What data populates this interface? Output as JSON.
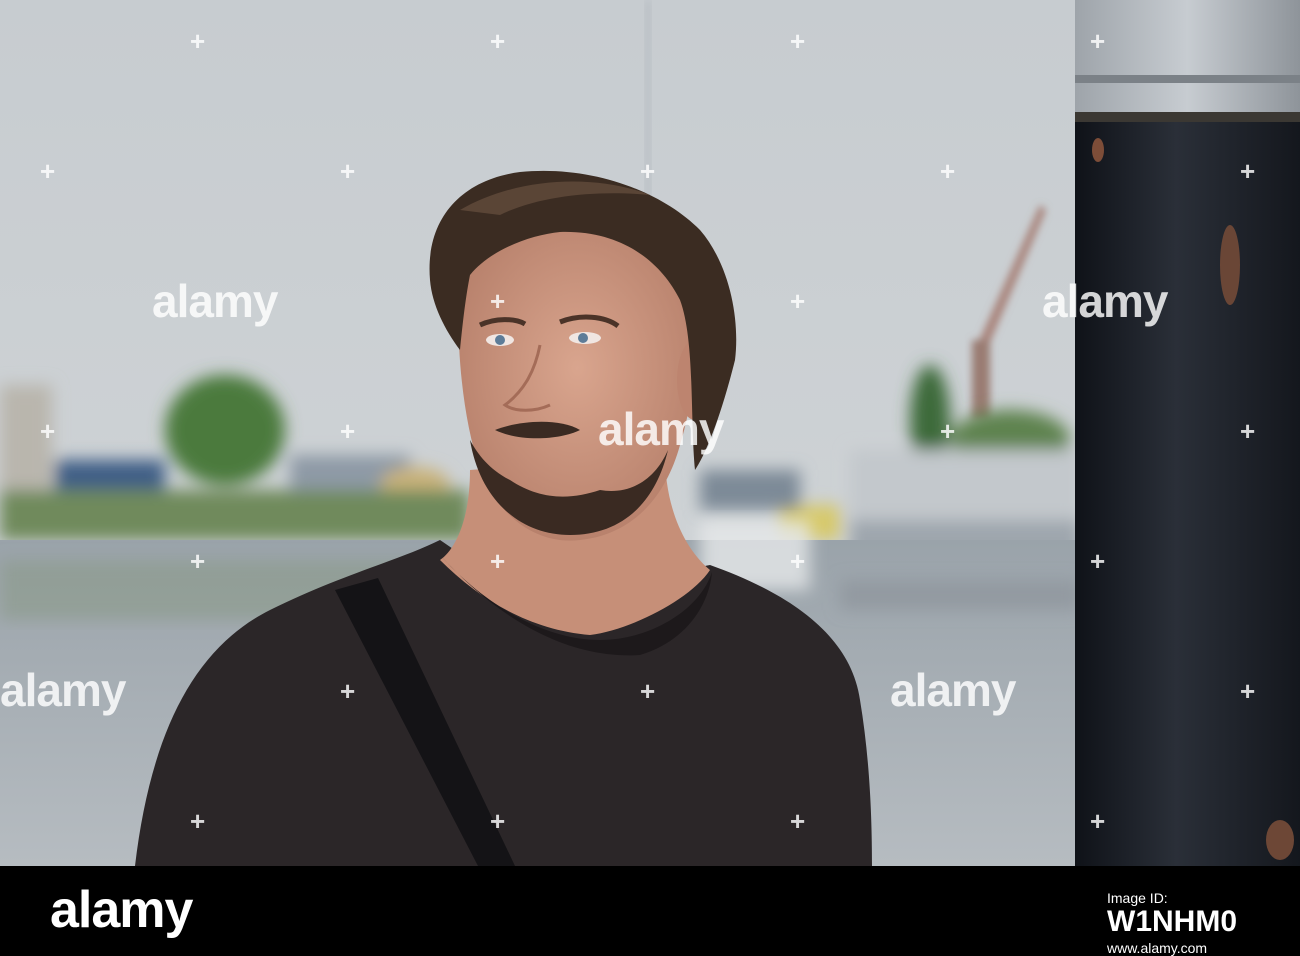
{
  "watermark": {
    "text": "alamy",
    "plus": "+"
  },
  "footer": {
    "logo": "alamy",
    "image_id_label": "Image ID:",
    "image_id": "W1NHM0",
    "url": "www.alamy.com"
  },
  "colors": {
    "sky": "#c9cdd0",
    "water": "#aab2b9",
    "shirt": "#2b2628",
    "pole": "#1c1f26",
    "footer": "#000000"
  }
}
